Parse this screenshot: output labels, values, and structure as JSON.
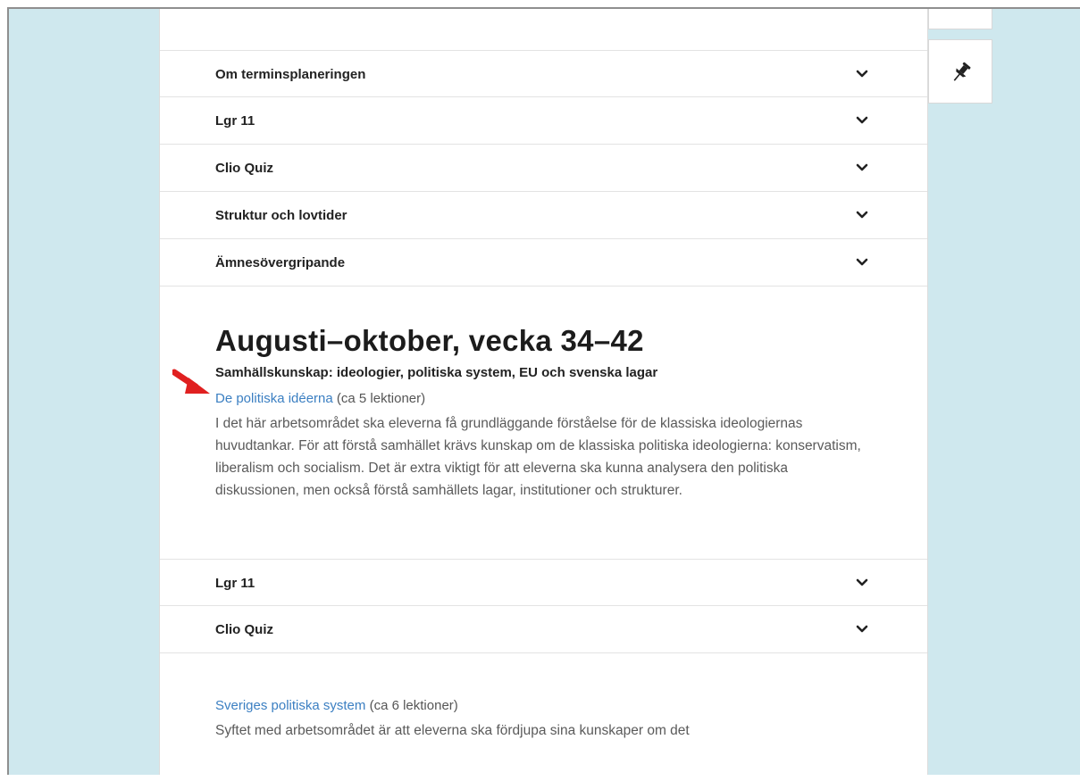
{
  "accordion_top": [
    {
      "label": "Om terminsplaneringen"
    },
    {
      "label": "Lgr 11"
    },
    {
      "label": "Clio Quiz"
    },
    {
      "label": "Struktur och lovtider"
    },
    {
      "label": "Ämnesövergripande"
    }
  ],
  "section": {
    "heading": "Augusti–oktober, vecka 34–42",
    "subheading": "Samhällskunskap: ideologier, politiska system, EU och svenska lagar",
    "link1_text": "De politiska idéerna",
    "link1_suffix": " (ca 5 lektioner)",
    "paragraph1": "I det här arbetsområdet ska eleverna få grundläggande förståelse för de klassiska ideologiernas huvudtankar. För att förstå samhället krävs kunskap om de klassiska politiska ideologierna: konservatism, liberalism och socialism. Det är extra viktigt för att eleverna ska kunna analysera den politiska diskussionen, men också förstå samhällets lagar, institutioner och strukturer."
  },
  "accordion_mid": [
    {
      "label": "Lgr 11"
    },
    {
      "label": "Clio Quiz"
    }
  ],
  "section2": {
    "link_text": "Sveriges politiska system",
    "link_suffix": " (ca 6 lektioner)",
    "paragraph": "Syftet med arbetsområdet är att eleverna ska fördjupa sina kunskaper om det"
  },
  "icons": {
    "chevron": "chevron-down-icon",
    "pin": "pin-icon",
    "annotation_arrow": "red-arrow-icon"
  },
  "colors": {
    "background": "#cfe8ee",
    "link": "#3b7fc2",
    "arrow": "#e02020"
  }
}
